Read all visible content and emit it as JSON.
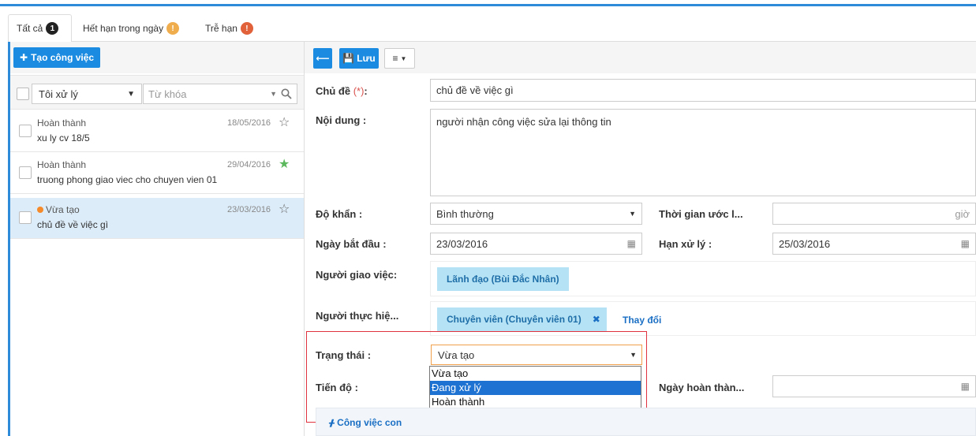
{
  "tabs": [
    {
      "label": "Tất cả",
      "badge": "1",
      "badge_color": "#222222"
    },
    {
      "label": "Hết hạn trong ngày",
      "badge": "!",
      "badge_color": "#f0ad4e"
    },
    {
      "label": "Trễ hạn",
      "badge": "!",
      "badge_color": "#e0613a"
    }
  ],
  "left": {
    "create_button": "Tạo công việc",
    "filter_select": "Tôi xử lý",
    "search_placeholder": "Từ khóa"
  },
  "tasks": [
    {
      "status": "Hoàn thành",
      "title": "xu ly cv 18/5",
      "date": "18/05/2016",
      "starred": false
    },
    {
      "status": "Hoàn thành",
      "title": "truong phong giao viec cho chuyen vien 01",
      "date": "29/04/2016",
      "starred": true
    },
    {
      "status": "Vừa tạo",
      "title": "chủ đề về việc gì",
      "date": "23/03/2016",
      "starred": false
    }
  ],
  "toolbar": {
    "save_label": "Lưu"
  },
  "form": {
    "subject_label": "Chủ đề",
    "subject_required": "(*)",
    "subject_value": "chủ đề về việc gì",
    "content_label": "Nội dung :",
    "content_value": "người nhận công việc sửa lại thông tin",
    "priority_label": "Độ khẩn :",
    "priority_value": "Bình thường",
    "estimate_label": "Thời gian ước l...",
    "estimate_placeholder": "giờ",
    "start_label": "Ngày bắt đầu :",
    "start_value": "23/03/2016",
    "deadline_label": "Hạn xử lý :",
    "deadline_value": "25/03/2016",
    "assigner_label": "Người giao việc:",
    "assigner_value": "Lãnh đạo (Bùi Đắc Nhân)",
    "assignee_label": "Người thực hiệ...",
    "assignee_value": "Chuyên viên (Chuyên viên 01)",
    "change_link": "Thay đổi",
    "status_label": "Trạng thái :",
    "status_value": "Vừa tạo",
    "status_options": [
      "Vừa tạo",
      "Đang xử lý",
      "Hoàn thành"
    ],
    "progress_label": "Tiến độ :",
    "complete_date_label": "Ngày hoàn thàn...",
    "subtask_title": "Công việc con"
  }
}
